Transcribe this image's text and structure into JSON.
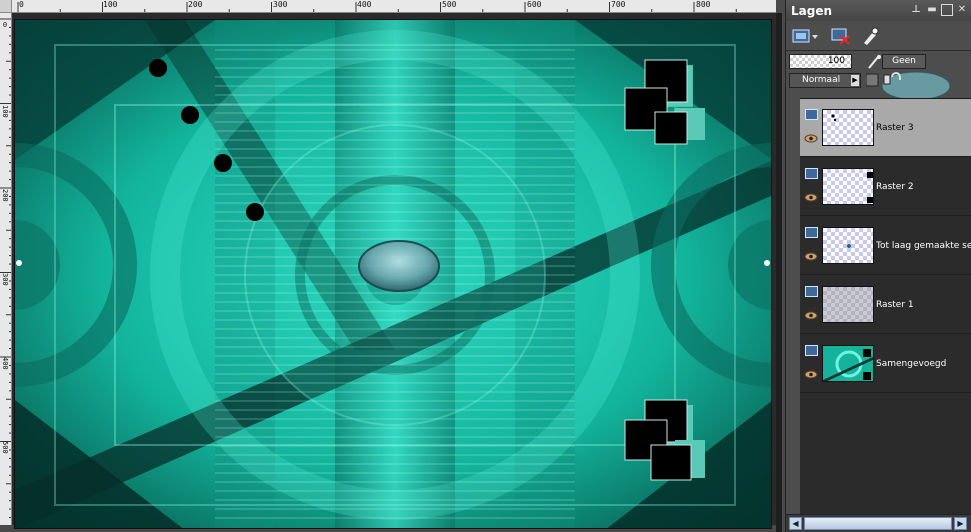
{
  "ruler": {
    "top_labels": [
      "0",
      "100",
      "200",
      "300",
      "400",
      "500",
      "600",
      "700",
      "800"
    ],
    "left_labels": [
      "0",
      "100",
      "200",
      "300",
      "400",
      "500"
    ]
  },
  "panel": {
    "title": "Lagen",
    "pin_icon": "pin-icon",
    "minimize_icon": "minimize-icon",
    "maximize_icon": "maximize-icon",
    "close_icon": "close-icon"
  },
  "toolbar": {
    "new_layer_icon": "new-layer-icon",
    "delete_layer_icon": "delete-layer-icon",
    "properties_icon": "layer-properties-icon"
  },
  "opacity": {
    "value": "100"
  },
  "mask": {
    "label": "Geen"
  },
  "blend": {
    "mode": "Normaal"
  },
  "layers": [
    {
      "name": "Raster 3",
      "selected": true,
      "visible": true
    },
    {
      "name": "Raster 2",
      "selected": false,
      "visible": true
    },
    {
      "name": "Tot laag gemaakte sele",
      "selected": false,
      "visible": true
    },
    {
      "name": "Raster 1",
      "selected": false,
      "visible": true
    },
    {
      "name": "Samengevoegd",
      "selected": false,
      "visible": true
    }
  ],
  "colors": {
    "accent": "#18c9b0",
    "canvas_dark": "#063a33",
    "canvas_light": "#3fe6cf",
    "panel_bg": "#4d4d4d",
    "layer_selected": "#a9a9a9"
  }
}
